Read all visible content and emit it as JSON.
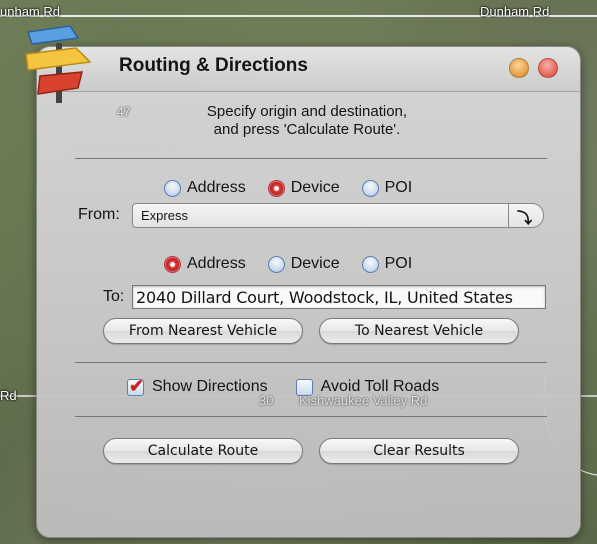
{
  "map": {
    "labels": {
      "dunham_left": "unham Rd",
      "dunham_right": "Dunham Rd",
      "rd_left": "Rd",
      "route_47": "47",
      "route_30": "30",
      "kishwaukee": "Kishwaukee Valley Rd"
    }
  },
  "dialog": {
    "title": "Routing & Directions",
    "instructions_line1": "Specify origin and destination,",
    "instructions_line2": "and press 'Calculate Route'."
  },
  "from": {
    "label": "From:",
    "options": [
      "Address",
      "Device",
      "POI"
    ],
    "selected": "Device",
    "combo_value": "Express"
  },
  "to": {
    "label": "To:",
    "options": [
      "Address",
      "Device",
      "POI"
    ],
    "selected": "Address",
    "value": "2040 Dillard Court, Woodstock, IL, United States"
  },
  "buttons": {
    "from_nearest": "From Nearest Vehicle",
    "to_nearest": "To Nearest Vehicle",
    "calculate": "Calculate Route",
    "clear": "Clear Results"
  },
  "options": {
    "show_directions": {
      "label": "Show Directions",
      "checked": true
    },
    "avoid_tolls": {
      "label": "Avoid Toll Roads",
      "checked": false
    }
  },
  "icons": {
    "logo": "signpost-icon",
    "combo_arrow": "return-arrow-icon"
  }
}
